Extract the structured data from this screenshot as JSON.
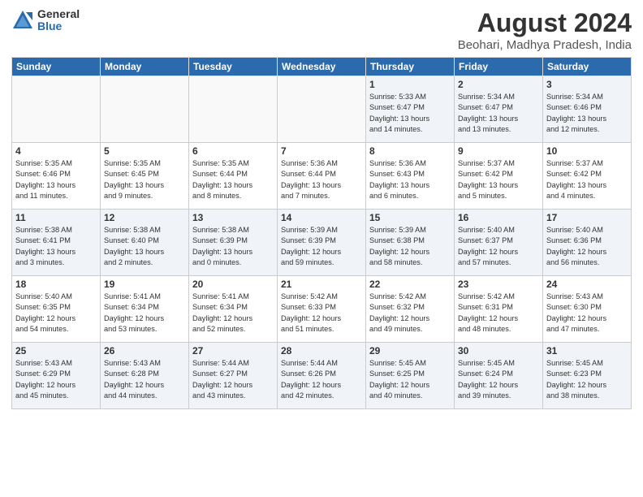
{
  "header": {
    "logo_general": "General",
    "logo_blue": "Blue",
    "month_year": "August 2024",
    "location": "Beohari, Madhya Pradesh, India"
  },
  "days_of_week": [
    "Sunday",
    "Monday",
    "Tuesday",
    "Wednesday",
    "Thursday",
    "Friday",
    "Saturday"
  ],
  "weeks": [
    [
      {
        "day": "",
        "info": ""
      },
      {
        "day": "",
        "info": ""
      },
      {
        "day": "",
        "info": ""
      },
      {
        "day": "",
        "info": ""
      },
      {
        "day": "1",
        "info": "Sunrise: 5:33 AM\nSunset: 6:47 PM\nDaylight: 13 hours\nand 14 minutes."
      },
      {
        "day": "2",
        "info": "Sunrise: 5:34 AM\nSunset: 6:47 PM\nDaylight: 13 hours\nand 13 minutes."
      },
      {
        "day": "3",
        "info": "Sunrise: 5:34 AM\nSunset: 6:46 PM\nDaylight: 13 hours\nand 12 minutes."
      }
    ],
    [
      {
        "day": "4",
        "info": "Sunrise: 5:35 AM\nSunset: 6:46 PM\nDaylight: 13 hours\nand 11 minutes."
      },
      {
        "day": "5",
        "info": "Sunrise: 5:35 AM\nSunset: 6:45 PM\nDaylight: 13 hours\nand 9 minutes."
      },
      {
        "day": "6",
        "info": "Sunrise: 5:35 AM\nSunset: 6:44 PM\nDaylight: 13 hours\nand 8 minutes."
      },
      {
        "day": "7",
        "info": "Sunrise: 5:36 AM\nSunset: 6:44 PM\nDaylight: 13 hours\nand 7 minutes."
      },
      {
        "day": "8",
        "info": "Sunrise: 5:36 AM\nSunset: 6:43 PM\nDaylight: 13 hours\nand 6 minutes."
      },
      {
        "day": "9",
        "info": "Sunrise: 5:37 AM\nSunset: 6:42 PM\nDaylight: 13 hours\nand 5 minutes."
      },
      {
        "day": "10",
        "info": "Sunrise: 5:37 AM\nSunset: 6:42 PM\nDaylight: 13 hours\nand 4 minutes."
      }
    ],
    [
      {
        "day": "11",
        "info": "Sunrise: 5:38 AM\nSunset: 6:41 PM\nDaylight: 13 hours\nand 3 minutes."
      },
      {
        "day": "12",
        "info": "Sunrise: 5:38 AM\nSunset: 6:40 PM\nDaylight: 13 hours\nand 2 minutes."
      },
      {
        "day": "13",
        "info": "Sunrise: 5:38 AM\nSunset: 6:39 PM\nDaylight: 13 hours\nand 0 minutes."
      },
      {
        "day": "14",
        "info": "Sunrise: 5:39 AM\nSunset: 6:39 PM\nDaylight: 12 hours\nand 59 minutes."
      },
      {
        "day": "15",
        "info": "Sunrise: 5:39 AM\nSunset: 6:38 PM\nDaylight: 12 hours\nand 58 minutes."
      },
      {
        "day": "16",
        "info": "Sunrise: 5:40 AM\nSunset: 6:37 PM\nDaylight: 12 hours\nand 57 minutes."
      },
      {
        "day": "17",
        "info": "Sunrise: 5:40 AM\nSunset: 6:36 PM\nDaylight: 12 hours\nand 56 minutes."
      }
    ],
    [
      {
        "day": "18",
        "info": "Sunrise: 5:40 AM\nSunset: 6:35 PM\nDaylight: 12 hours\nand 54 minutes."
      },
      {
        "day": "19",
        "info": "Sunrise: 5:41 AM\nSunset: 6:34 PM\nDaylight: 12 hours\nand 53 minutes."
      },
      {
        "day": "20",
        "info": "Sunrise: 5:41 AM\nSunset: 6:34 PM\nDaylight: 12 hours\nand 52 minutes."
      },
      {
        "day": "21",
        "info": "Sunrise: 5:42 AM\nSunset: 6:33 PM\nDaylight: 12 hours\nand 51 minutes."
      },
      {
        "day": "22",
        "info": "Sunrise: 5:42 AM\nSunset: 6:32 PM\nDaylight: 12 hours\nand 49 minutes."
      },
      {
        "day": "23",
        "info": "Sunrise: 5:42 AM\nSunset: 6:31 PM\nDaylight: 12 hours\nand 48 minutes."
      },
      {
        "day": "24",
        "info": "Sunrise: 5:43 AM\nSunset: 6:30 PM\nDaylight: 12 hours\nand 47 minutes."
      }
    ],
    [
      {
        "day": "25",
        "info": "Sunrise: 5:43 AM\nSunset: 6:29 PM\nDaylight: 12 hours\nand 45 minutes."
      },
      {
        "day": "26",
        "info": "Sunrise: 5:43 AM\nSunset: 6:28 PM\nDaylight: 12 hours\nand 44 minutes."
      },
      {
        "day": "27",
        "info": "Sunrise: 5:44 AM\nSunset: 6:27 PM\nDaylight: 12 hours\nand 43 minutes."
      },
      {
        "day": "28",
        "info": "Sunrise: 5:44 AM\nSunset: 6:26 PM\nDaylight: 12 hours\nand 42 minutes."
      },
      {
        "day": "29",
        "info": "Sunrise: 5:45 AM\nSunset: 6:25 PM\nDaylight: 12 hours\nand 40 minutes."
      },
      {
        "day": "30",
        "info": "Sunrise: 5:45 AM\nSunset: 6:24 PM\nDaylight: 12 hours\nand 39 minutes."
      },
      {
        "day": "31",
        "info": "Sunrise: 5:45 AM\nSunset: 6:23 PM\nDaylight: 12 hours\nand 38 minutes."
      }
    ]
  ]
}
